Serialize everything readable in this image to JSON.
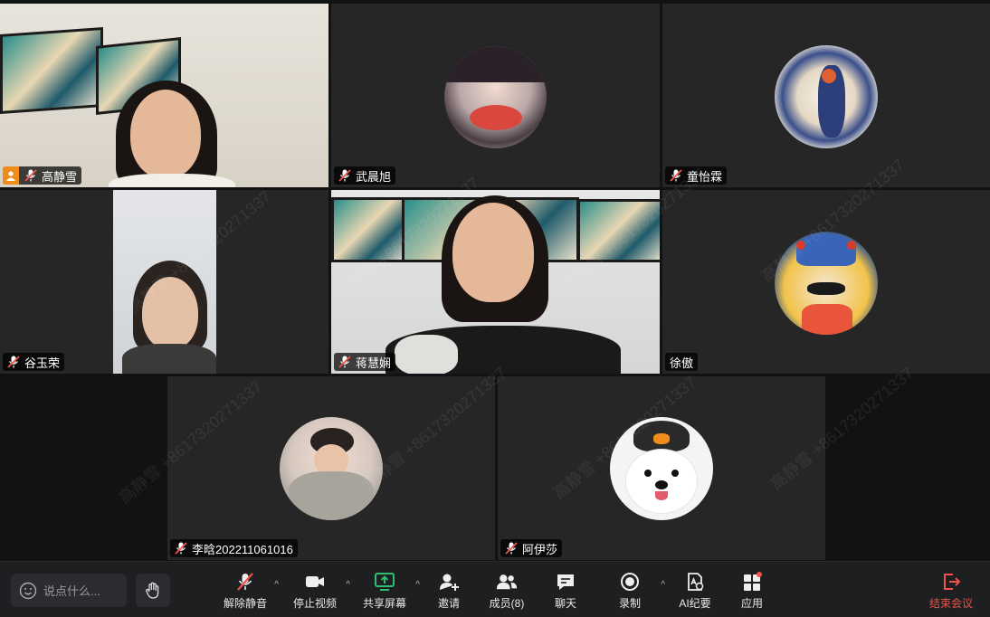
{
  "participants": [
    {
      "name": "高静雪",
      "host": true
    },
    {
      "name": "武晨旭"
    },
    {
      "name": "童怡霖"
    },
    {
      "name": "谷玉荣"
    },
    {
      "name": "蒋慧娴"
    },
    {
      "name": "徐傲"
    },
    {
      "name": "李晗202211061016"
    },
    {
      "name": "阿伊莎"
    }
  ],
  "watermark": "高静雪 +8617320271337",
  "toolbar": {
    "chat_placeholder": "说点什么...",
    "mute_label": "解除静音",
    "video_label": "停止视频",
    "share_label": "共享屏幕",
    "invite_label": "邀请",
    "members_label": "成员(8)",
    "chat_label": "聊天",
    "record_label": "录制",
    "ai_label": "AI纪要",
    "apps_label": "应用",
    "end_label": "结束会议"
  },
  "colors": {
    "accent_green": "#2fbf71",
    "end_red": "#f0524c",
    "host_orange": "#f08c1c"
  }
}
